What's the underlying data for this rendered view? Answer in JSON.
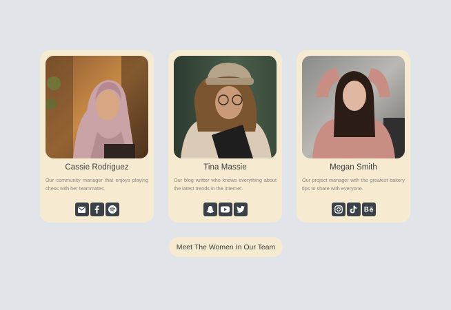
{
  "cards": [
    {
      "name": "Cassie Rodriguez",
      "bio": "Our community manager that enjoys playing chess with her teammates.",
      "socials": [
        "envelope-icon",
        "facebook-icon",
        "spotify-icon"
      ]
    },
    {
      "name": "Tina Massie",
      "bio": "Our blog writter who knows everything about the latest trends in the internet.",
      "socials": [
        "snapchat-icon",
        "youtube-icon",
        "twitter-icon"
      ]
    },
    {
      "name": "Megan Smith",
      "bio": "Our project manager with the greatest bakery tips to share with everyone.",
      "socials": [
        "instagram-icon",
        "tiktok-icon",
        "behance-icon"
      ]
    }
  ],
  "cta": {
    "label": "Meet The Women In Our Team"
  },
  "colors": {
    "background": "#e1e5ea",
    "card": "#f6ebd1",
    "icon_bg": "#3a4247",
    "text": "#3b3b3b",
    "muted": "#8a8680"
  }
}
